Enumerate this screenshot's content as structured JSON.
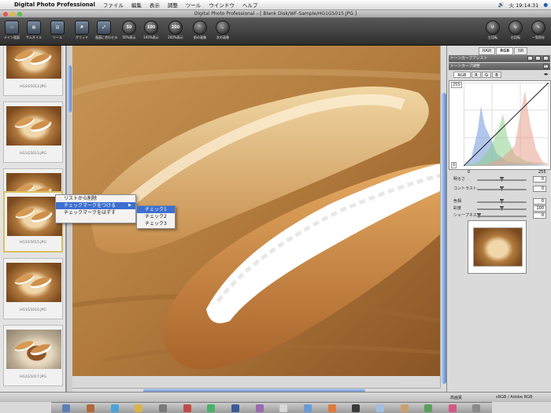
{
  "menubar": {
    "app_name": "Digital Photo Professional",
    "items": [
      "ファイル",
      "編集",
      "表示",
      "調整",
      "ツール",
      "ウインドウ",
      "ヘルプ"
    ],
    "clock": "火 19:14:31"
  },
  "window": {
    "title": "Digital Photo Professional – [ Blank Disk/WF-Sample/HG1G5015.JPG ]"
  },
  "toolbar": {
    "left": [
      {
        "label": "メイン画面",
        "icon": "main-window-icon"
      },
      {
        "label": "サムネイル",
        "icon": "thumbnail-icon"
      },
      {
        "label": "ツール",
        "icon": "tool-icon"
      },
      {
        "label": "グリッド",
        "icon": "grid-icon"
      },
      {
        "label": "画面に合わせる",
        "icon": "fit-screen-icon"
      },
      {
        "label": "50%表示",
        "icon": "zoom-50-icon",
        "text": "50"
      },
      {
        "label": "100%表示",
        "icon": "zoom-100-icon",
        "text": "100"
      },
      {
        "label": "200%表示",
        "icon": "zoom-200-icon",
        "text": "200"
      },
      {
        "label": "前の画像",
        "icon": "prev-image-icon",
        "text": "⌃"
      },
      {
        "label": "次の画像",
        "icon": "next-image-icon",
        "text": "⌄"
      }
    ],
    "right": [
      {
        "label": "左回転",
        "icon": "rotate-left-icon",
        "text": "↺"
      },
      {
        "label": "右回転",
        "icon": "rotate-right-icon",
        "text": "↻"
      },
      {
        "label": "一覧保存",
        "icon": "save-list-icon",
        "text": "✎"
      }
    ]
  },
  "filmstrip": {
    "items": [
      {
        "name": "HG1G5012.JPG",
        "type": "bread"
      },
      {
        "name": "HG1G5013.JPG",
        "type": "bread"
      },
      {
        "name": "HG1G5014.JPG",
        "type": "bread"
      },
      {
        "name": "HG1G5015.JPG",
        "type": "bread",
        "selected": true
      },
      {
        "name": "HG1G5016.JPG",
        "type": "bread"
      },
      {
        "name": "HG1G5017.JPG",
        "type": "plate"
      }
    ]
  },
  "context_menu": {
    "items": [
      {
        "label": "リストから削除"
      },
      {
        "label": "チェックマークをつける",
        "highlighted": true,
        "submenu": true
      },
      {
        "label": "チェックマークをはずす"
      }
    ],
    "submenu": [
      "チェック1",
      "チェック2",
      "チェック3"
    ]
  },
  "panel": {
    "tabs": [
      "RAW",
      "RGB",
      "NR"
    ],
    "active_tab": "RGB",
    "tone_curve_assist": "トーンカーブアシスト",
    "tone_curve_adjust": "トーンカーブ調整",
    "channels": [
      "RGB",
      "R",
      "G",
      "B"
    ],
    "graph_top_left": "255",
    "graph_bottom_left": "0",
    "axis_min": "0",
    "axis_max": "255",
    "adjustments": [
      {
        "label": "明るさ",
        "value": "0",
        "level": 0.5
      },
      {
        "label": "コントラスト",
        "value": "0",
        "level": 0.5
      },
      {
        "label": "色相",
        "value": "0",
        "level": 0.5
      },
      {
        "label": "彩度",
        "value": "100",
        "level": 0.5
      },
      {
        "label": "シャープネス",
        "value": "0",
        "level": 0.0
      }
    ]
  },
  "status": {
    "quality": "高画質",
    "color_space": "sRGB / Adobe RGB"
  },
  "colors": {
    "highlight": "#3c6fd0",
    "toolbar_bg": "#3a3a3a"
  }
}
